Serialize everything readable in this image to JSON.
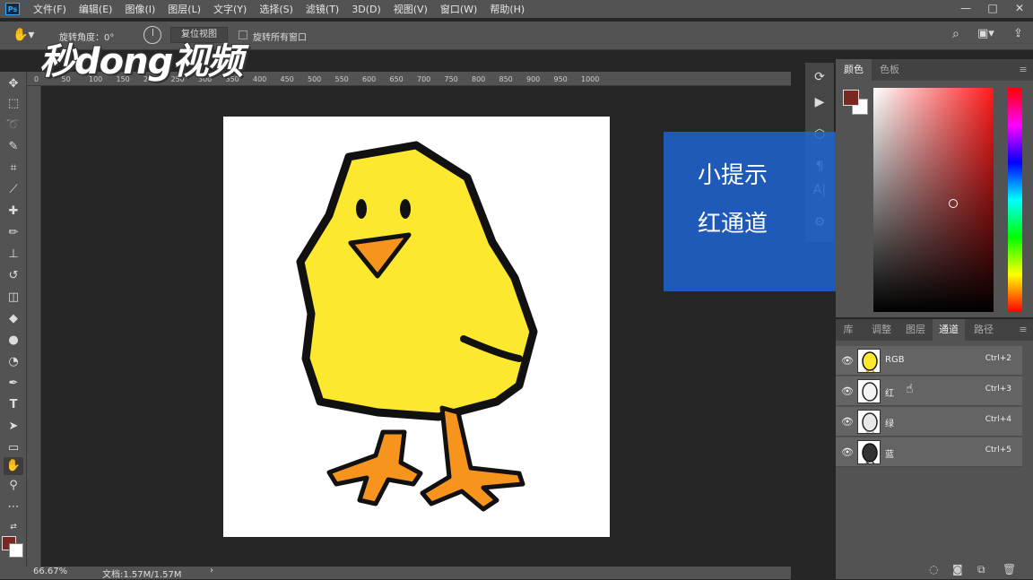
{
  "app": {
    "logo": "Ps"
  },
  "menu": [
    "文件(F)",
    "编辑(E)",
    "图像(I)",
    "图层(L)",
    "文字(Y)",
    "选择(S)",
    "滤镜(T)",
    "3D(D)",
    "视图(V)",
    "窗口(W)",
    "帮助(H)"
  ],
  "window_controls": {
    "minimize": "—",
    "maximize": "□",
    "close": "✕"
  },
  "options": {
    "angle_label": "旋转角度：0°",
    "reset_view": "复位视图",
    "rotate_all": "旋转所有窗口"
  },
  "watermark": "秒dong视频",
  "ruler_ticks": [
    "0",
    "50",
    "100",
    "150",
    "200",
    "250",
    "300",
    "350",
    "400",
    "450",
    "500",
    "550",
    "600",
    "650",
    "700",
    "750",
    "800",
    "850",
    "900",
    "950",
    "1000"
  ],
  "status": {
    "zoom": "66.67%",
    "doc": "文档:1.57M/1.57M",
    "arrow": "›"
  },
  "tip": {
    "line1": "小提示",
    "line2": "红通道"
  },
  "color_panel": {
    "tabs": [
      "颜色",
      "色板"
    ]
  },
  "channels_panel": {
    "tabs": [
      "库",
      "调整",
      "图层",
      "通道",
      "路径"
    ],
    "channels": [
      {
        "name": "RGB",
        "shortcut": "Ctrl+2"
      },
      {
        "name": "红",
        "shortcut": "Ctrl+3"
      },
      {
        "name": "绿",
        "shortcut": "Ctrl+4"
      },
      {
        "name": "蓝",
        "shortcut": "Ctrl+5"
      }
    ]
  },
  "colors": {
    "foreground": "#7a2822",
    "background": "#ffffff",
    "tip_bg": "#1e64d2",
    "chick_body": "#fce82e",
    "chick_beak": "#f7941d"
  }
}
